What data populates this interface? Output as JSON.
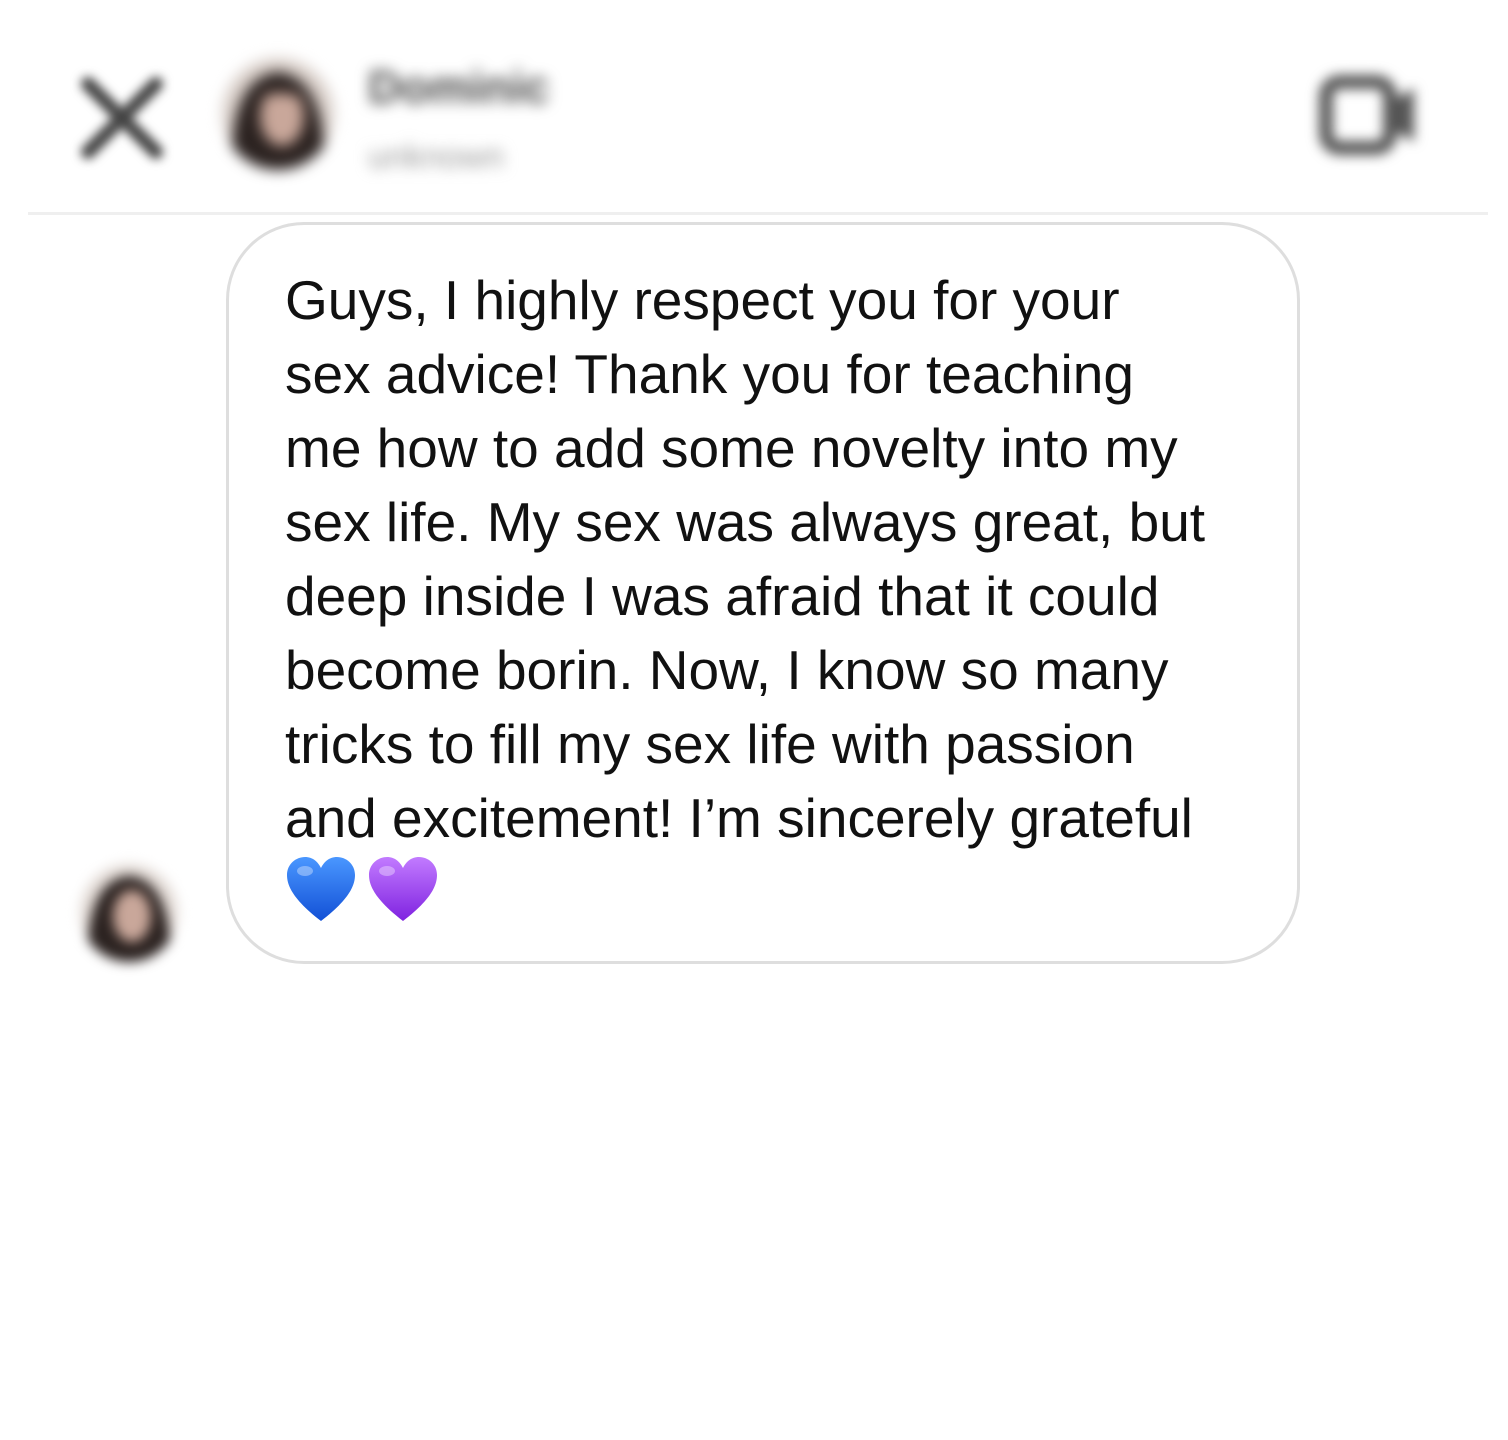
{
  "header": {
    "contact_name": "Dominic",
    "contact_status": "unknown",
    "icons": {
      "close": "close-icon",
      "video": "video-camera-icon"
    }
  },
  "message": {
    "lines": [
      "Guys, I highly respect you for your",
      "sex advice! Thank you for teaching",
      "me how to add some novelty into my",
      "sex life. My sex was always great, but",
      "deep inside I was afraid that it could",
      "become borin. Now, I know so many",
      "tricks to fill my sex life with passion",
      "and excitement! I’m sincerely grateful"
    ],
    "emojis": [
      "blue-heart-icon",
      "purple-heart-icon"
    ]
  },
  "colors": {
    "text": "#111111",
    "bubble_border": "#dedede",
    "divider": "#efefef",
    "blue_heart": "#1f6fe8",
    "purple_heart": "#9b3ff0"
  }
}
